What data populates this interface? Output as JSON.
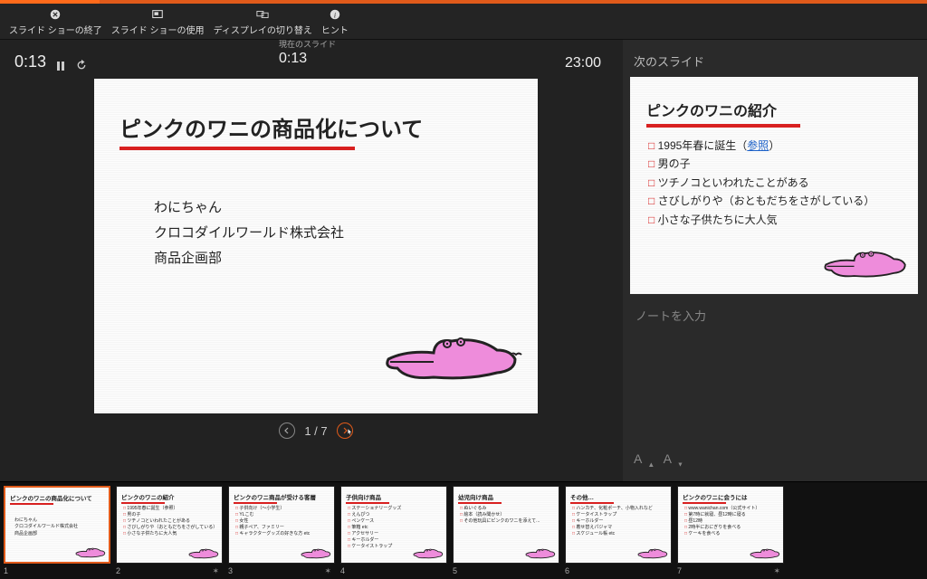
{
  "toolbar": {
    "end_show": "スライド ショーの終了",
    "use_show": "スライド ショーの使用",
    "switch_display": "ディスプレイの切り替え",
    "hints": "ヒント"
  },
  "timers": {
    "elapsed": "0:13",
    "current_slide_label": "現在のスライド",
    "current_slide_time": "0:13",
    "clock": "23:00"
  },
  "main_slide": {
    "title": "ピンクのワニの商品化について",
    "body_lines": [
      "わにちゃん",
      "クロコダイルワールド株式会社",
      "商品企画部"
    ]
  },
  "navigation": {
    "position": "1 / 7"
  },
  "right_pane": {
    "next_slide_label": "次のスライド",
    "notes_placeholder": "ノートを入力",
    "font_bigger": "A",
    "font_smaller": "A"
  },
  "next_slide": {
    "title": "ピンクのワニの紹介",
    "items": [
      {
        "text": "1995年春に誕生（",
        "link": "参照",
        "suffix": "）"
      },
      {
        "text": "男の子"
      },
      {
        "text": "ツチノコといわれたことがある"
      },
      {
        "text": "さびしがりや（おともだちをさがしている）"
      },
      {
        "text": "小さな子供たちに大人気"
      }
    ]
  },
  "thumbnails": [
    {
      "n": "1",
      "title": "ピンクのワニの商品化について",
      "lines": [
        "わにちゃん",
        "クロコダイルワールド株式会社",
        "商品企画部"
      ],
      "star": false,
      "croc": true,
      "big": true
    },
    {
      "n": "2",
      "title": "ピンクのワニの紹介",
      "lines": [
        "1995年春に誕生（参照）",
        "男の子",
        "ツチノコといわれたことがある",
        "さびしがりや（おともだちをさがしている）",
        "小さな子供たちに大人気"
      ],
      "star": true,
      "croc": true
    },
    {
      "n": "3",
      "title": "ピンクのワニ商品が受ける客層",
      "lines": [
        "子供向け（～小学生）",
        "YLこむ",
        "女性",
        "親子ペア、ファミリー",
        "キャラクターグッズの好きな方 etc"
      ],
      "star": true,
      "croc": true
    },
    {
      "n": "4",
      "title": "子供向け商品",
      "lines": [
        "ステーショナリーグッズ",
        "えんぴつ",
        "ペンケース",
        "筆箱 etc",
        "アクセサリー",
        "キーホルダー",
        "ケータイストラップ"
      ],
      "star": false,
      "croc": true
    },
    {
      "n": "5",
      "title": "幼児向け商品",
      "lines": [
        "ぬいぐるみ",
        "絵本（読み聞かせ）",
        "その他玩具にピンクのワニを添えて..."
      ],
      "star": false,
      "croc": true
    },
    {
      "n": "6",
      "title": "その他…",
      "lines": [
        "ハンカチ、化粧ポーチ、小物入れなど",
        "ケータイストラップ",
        "キーホルダー",
        "着せ替えパジャマ",
        "スケジュール帳 etc"
      ],
      "star": false,
      "croc": true
    },
    {
      "n": "7",
      "title": "ピンクのワニに会うには",
      "lines": [
        "www.wanichan.com（公式サイト）",
        "第7時に就寝、昼12時に寝る",
        "昼12時",
        "2時半におにぎりを食べる",
        "ケーキを食べる"
      ],
      "star": true,
      "croc": true
    }
  ]
}
